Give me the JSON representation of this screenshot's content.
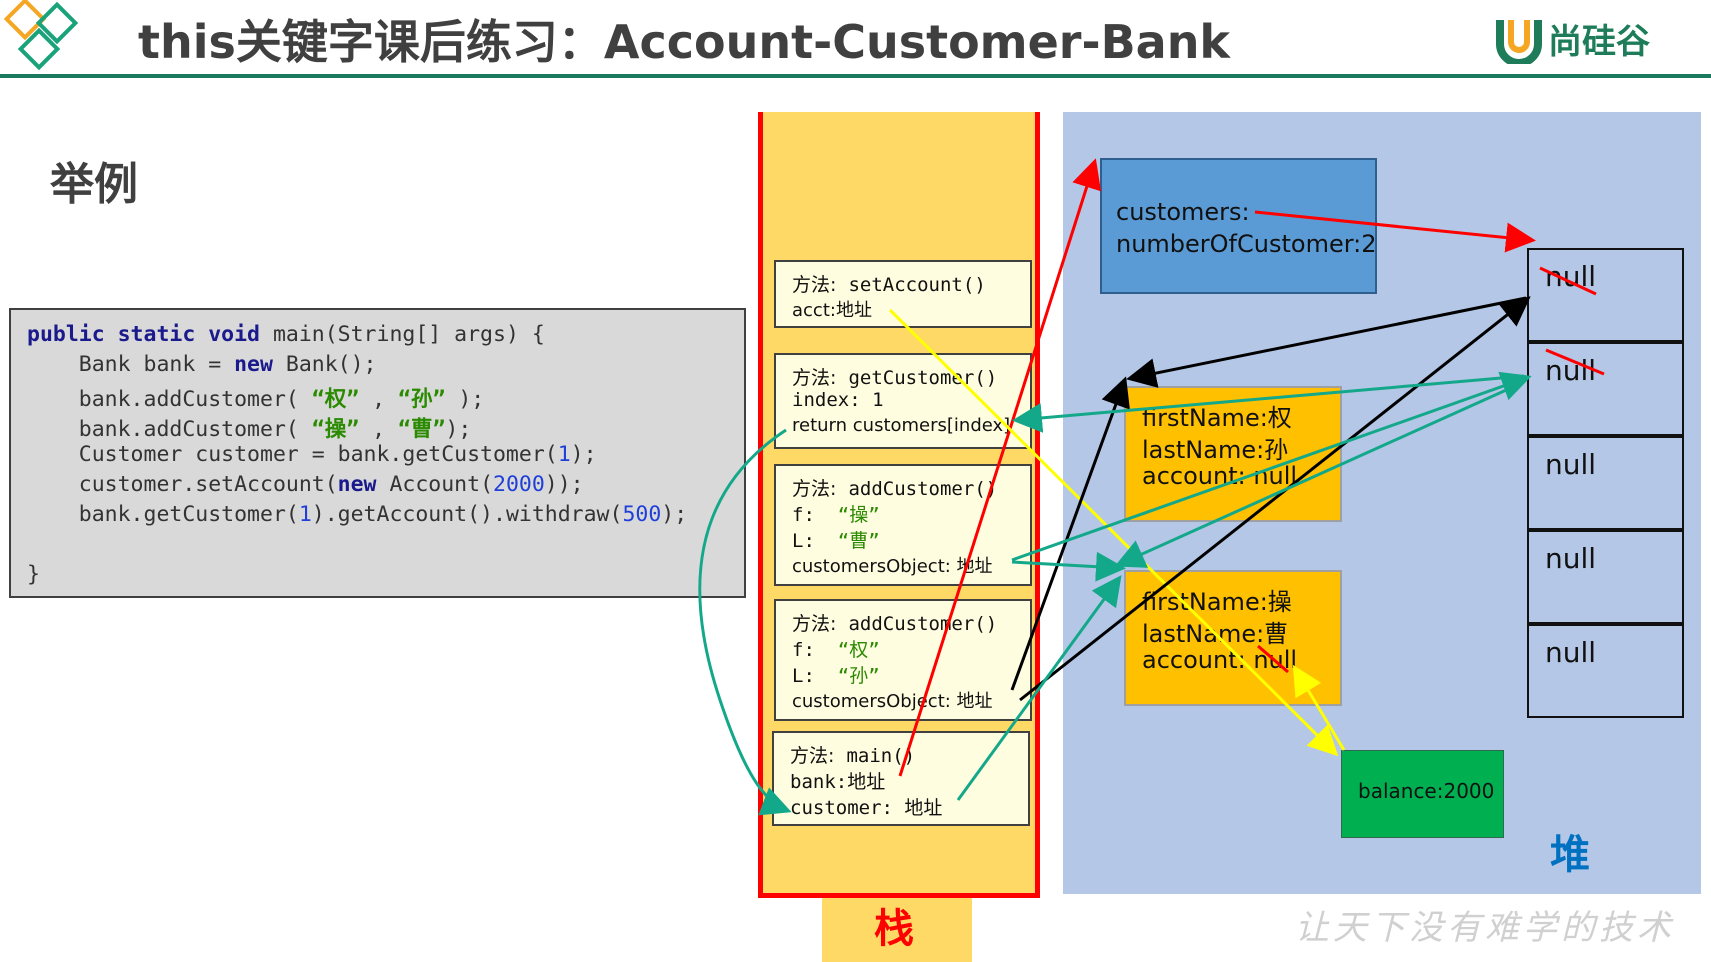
{
  "header": {
    "title": "this关键字课后练习：Account-Customer-Bank",
    "brand_text": "尚硅谷"
  },
  "section_title": "举例",
  "code": {
    "lines": [
      [
        {
          "t": "public static void",
          "c": "kw"
        },
        {
          "t": " main(String[] args) {"
        }
      ],
      [
        {
          "t": "    Bank bank = "
        },
        {
          "t": "new",
          "c": "kw"
        },
        {
          "t": " Bank();"
        }
      ],
      [
        {
          "t": "    bank.addCustomer( "
        },
        {
          "t": "“权”",
          "c": "str"
        },
        {
          "t": " , "
        },
        {
          "t": "“孙”",
          "c": "str"
        },
        {
          "t": " );"
        }
      ],
      [
        {
          "t": "    bank.addCustomer( "
        },
        {
          "t": "“操”",
          "c": "str"
        },
        {
          "t": " , "
        },
        {
          "t": "“曹”",
          "c": "str"
        },
        {
          "t": ");"
        }
      ],
      [
        {
          "t": "    Customer customer = bank.getCustomer("
        },
        {
          "t": "1",
          "c": "num"
        },
        {
          "t": ");"
        }
      ],
      [
        {
          "t": "    customer.setAccount("
        },
        {
          "t": "new",
          "c": "kw"
        },
        {
          "t": " Account("
        },
        {
          "t": "2000",
          "c": "num"
        },
        {
          "t": "));"
        }
      ],
      [
        {
          "t": "    bank.getCustomer("
        },
        {
          "t": "1",
          "c": "num"
        },
        {
          "t": ").getAccount().withdraw("
        },
        {
          "t": "500",
          "c": "num"
        },
        {
          "t": ");"
        }
      ],
      [
        {
          "t": ""
        }
      ],
      [
        {
          "t": "}"
        }
      ]
    ]
  },
  "stack": {
    "label": "栈",
    "frames": [
      {
        "title_key": "方法:",
        "title_val": "setAccount()",
        "lines": [
          {
            "text": "acct:地址"
          }
        ]
      },
      {
        "title_key": "方法:",
        "title_val": "getCustomer()",
        "lines": [
          {
            "text": "index: 1"
          },
          {
            "text": "return customers[index]"
          }
        ]
      },
      {
        "title_key": "方法:",
        "title_val": "addCustomer()",
        "lines": [
          {
            "text": "f:  “操”",
            "green": "“操”"
          },
          {
            "text": "L:  “曹”",
            "green": "“曹”"
          },
          {
            "text": "customersObject: 地址"
          }
        ]
      },
      {
        "title_key": "方法:",
        "title_val": "addCustomer()",
        "lines": [
          {
            "text": "f:  “权”",
            "green": "“权”"
          },
          {
            "text": "L:  “孙”",
            "green": "“孙”"
          },
          {
            "text": "customersObject: 地址"
          }
        ]
      },
      {
        "title_key": "方法:",
        "title_val": "main()",
        "lines": [
          {
            "text": "bank:地址"
          },
          {
            "text": "customer: 地址"
          }
        ]
      }
    ]
  },
  "heap": {
    "label": "堆",
    "bank_object": {
      "line1": "customers:",
      "line2": "numberOfCustomer:2"
    },
    "customer1": {
      "first": "firstName:权",
      "last": "lastName:孙",
      "account": "account: null"
    },
    "customer2": {
      "first": "firstName:操",
      "last": "lastName:曹",
      "account": "account: null"
    },
    "account": {
      "balance": "balance:2000"
    },
    "array": [
      "null",
      "null",
      "null",
      "null",
      "null"
    ]
  },
  "slogan": "让天下没有难学的技术",
  "colors": {
    "stack_fill": "#ffd966",
    "stack_border": "#ff0000",
    "heap_fill": "#b4c7e7",
    "bank_fill": "#5b9bd5",
    "customer_fill": "#ffc000",
    "account_fill": "#00b050",
    "arrow_red": "#ff0000",
    "arrow_yellow": "#ffff00",
    "arrow_teal": "#13a88a",
    "arrow_black": "#000000"
  }
}
